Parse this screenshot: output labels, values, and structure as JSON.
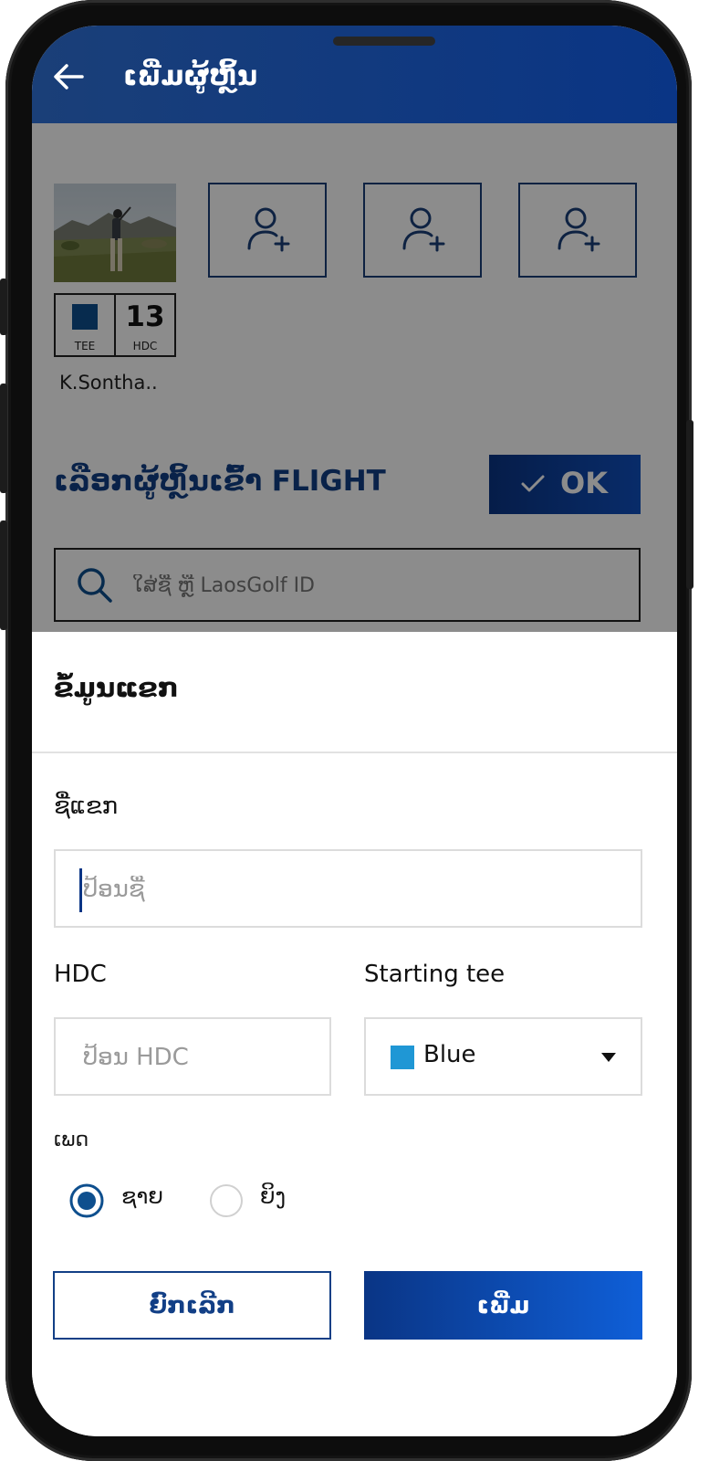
{
  "header": {
    "back_icon": "arrow-left-icon",
    "title": "ເພີ່ມຜູ້ຫຼິ້ນ"
  },
  "players": {
    "selected": {
      "name": "K.Sontha..",
      "tee_label": "TEE",
      "hdc_label": "HDC",
      "hdc_value": "13",
      "tee_color": "#0e4f8e"
    },
    "empty_slot_icon": "add-user-icon"
  },
  "flight": {
    "title": "ເລືອກຜູ້ຫຼິ້ນເຂົ້າ FLIGHT",
    "ok_icon": "check-icon",
    "ok_label": "OK"
  },
  "search": {
    "icon": "search-icon",
    "placeholder": "ໃສ່ຊື່ ຫຼື LaosGolf ID"
  },
  "sheet": {
    "title": "ຂໍ້ມູນແຂກ",
    "name_label": "ຊື່ແຂກ",
    "name_placeholder": "ປ້ອນຊື່",
    "hdc_label": "HDC",
    "hdc_placeholder": "ປ້ອນ HDC",
    "tee_label": "Starting tee",
    "tee_value": "Blue",
    "tee_color": "#1f97d5",
    "gender_label": "ເພດ",
    "gender_male": "ຊາຍ",
    "gender_female": "ຍິງ",
    "gender_selected": "male",
    "cancel_label": "ຍົກເລີກ",
    "add_label": "ເພີ່ມ"
  },
  "colors": {
    "brand": "#0a3585",
    "brand_light": "#0f5fd8",
    "accent_blue": "#1f97d5"
  }
}
